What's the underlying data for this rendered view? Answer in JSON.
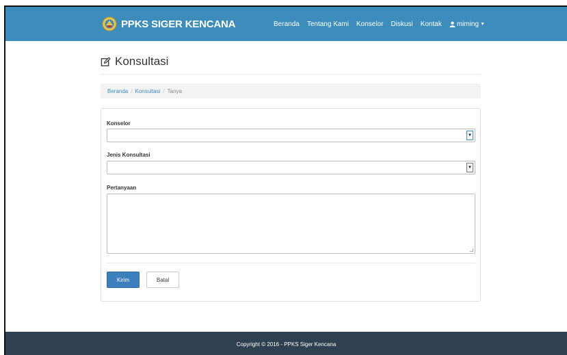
{
  "navbar": {
    "brand": "PPKS SIGER KENCANA",
    "items": [
      {
        "label": "Beranda"
      },
      {
        "label": "Tentang Kami"
      },
      {
        "label": "Konselor"
      },
      {
        "label": "Diskusi"
      },
      {
        "label": "Kontak"
      }
    ],
    "user": {
      "label": "miming",
      "icon": "user-icon"
    }
  },
  "page": {
    "title": "Konsultasi",
    "title_icon": "edit-icon"
  },
  "breadcrumb": {
    "items": [
      "Beranda",
      "Konsultasi"
    ],
    "active": "Tanya"
  },
  "form": {
    "konselor": {
      "label": "Konselor",
      "value": ""
    },
    "jenis": {
      "label": "Jenis Konsultasi",
      "value": ""
    },
    "pertanyaan": {
      "label": "Pertanyaan",
      "value": ""
    },
    "submit_label": "Kirim",
    "cancel_label": "Batal"
  },
  "footer": {
    "text": "Copyright © 2016 - PPKS Siger Kencana"
  },
  "colors": {
    "navbar": "#3c8dbc",
    "footer": "#2f4050",
    "primary_button": "#3c7fbc"
  }
}
